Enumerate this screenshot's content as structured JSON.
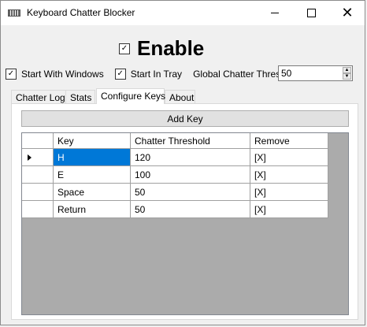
{
  "window": {
    "title": "Keyboard Chatter Blocker",
    "minimize_glyph": "",
    "close_glyph": "✕"
  },
  "enable": {
    "label": "Enable",
    "checked": true,
    "check_glyph": "✓"
  },
  "options": {
    "start_with_windows": {
      "label": "Start With Windows",
      "checked": true
    },
    "start_in_tray": {
      "label": "Start In Tray",
      "checked": true
    },
    "check_glyph": "✓",
    "threshold_label": "Global Chatter Threshold:",
    "threshold_value": "50",
    "spin_up_glyph": "▲",
    "spin_down_glyph": "▼"
  },
  "tabs": [
    {
      "label": "Chatter Log",
      "active": false
    },
    {
      "label": "Stats",
      "active": false
    },
    {
      "label": "Configure Keys",
      "active": true
    },
    {
      "label": "About",
      "active": false
    }
  ],
  "configure_keys": {
    "add_key_label": "Add Key",
    "columns": [
      "Key",
      "Chatter Threshold",
      "Remove"
    ],
    "rows": [
      {
        "key": "H",
        "threshold": "120",
        "remove": "[X]",
        "current": true
      },
      {
        "key": "E",
        "threshold": "100",
        "remove": "[X]",
        "current": false
      },
      {
        "key": "Space",
        "threshold": "50",
        "remove": "[X]",
        "current": false
      },
      {
        "key": "Return",
        "threshold": "50",
        "remove": "[X]",
        "current": false
      }
    ]
  },
  "colors": {
    "selection": "#0078d7",
    "grid_background": "#ababab",
    "window_background": "#f0f0f0"
  }
}
